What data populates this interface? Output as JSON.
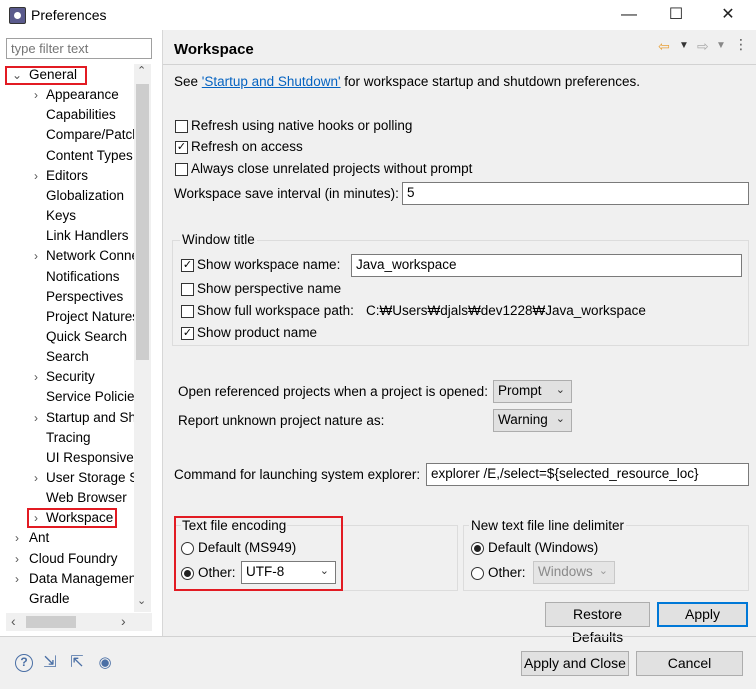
{
  "window": {
    "title": "Preferences",
    "minimize": "—",
    "maximize": "☐",
    "close": "✕"
  },
  "filter": {
    "placeholder": "type filter text"
  },
  "tree": {
    "items": [
      {
        "label": "General",
        "chevron": "⌄"
      },
      {
        "label": "Appearance",
        "chevron": "›"
      },
      {
        "label": "Capabilities",
        "chevron": ""
      },
      {
        "label": "Compare/Patch",
        "chevron": ""
      },
      {
        "label": "Content Types",
        "chevron": ""
      },
      {
        "label": "Editors",
        "chevron": "›"
      },
      {
        "label": "Globalization",
        "chevron": ""
      },
      {
        "label": "Keys",
        "chevron": ""
      },
      {
        "label": "Link Handlers",
        "chevron": ""
      },
      {
        "label": "Network Connections",
        "chevron": "›"
      },
      {
        "label": "Notifications",
        "chevron": ""
      },
      {
        "label": "Perspectives",
        "chevron": ""
      },
      {
        "label": "Project Natures",
        "chevron": ""
      },
      {
        "label": "Quick Search",
        "chevron": ""
      },
      {
        "label": "Search",
        "chevron": ""
      },
      {
        "label": "Security",
        "chevron": "›"
      },
      {
        "label": "Service Policies",
        "chevron": ""
      },
      {
        "label": "Startup and Shutdown",
        "chevron": "›"
      },
      {
        "label": "Tracing",
        "chevron": ""
      },
      {
        "label": "UI Responsiveness",
        "chevron": ""
      },
      {
        "label": "User Storage Service",
        "chevron": "›"
      },
      {
        "label": "Web Browser",
        "chevron": ""
      },
      {
        "label": "Workspace",
        "chevron": "›"
      },
      {
        "label": "Ant",
        "chevron": "›"
      },
      {
        "label": "Cloud Foundry",
        "chevron": "›"
      },
      {
        "label": "Data Management",
        "chevron": "›"
      },
      {
        "label": "Gradle",
        "chevron": ""
      }
    ],
    "scroll_up": "⌃",
    "scroll_down": "⌄",
    "scroll_left": "‹",
    "scroll_right": "›"
  },
  "page": {
    "title": "Workspace",
    "intro_prefix": "See ",
    "intro_link": "'Startup and Shutdown'",
    "intro_suffix": " for workspace startup and shutdown preferences.",
    "refresh_native": {
      "label": "Refresh using native hooks or polling",
      "checked": false
    },
    "refresh_access": {
      "label": "Refresh on access",
      "checked": true
    },
    "always_close": {
      "label": "Always close unrelated projects without prompt",
      "checked": false
    },
    "save_interval_label": "Workspace save interval (in minutes):",
    "save_interval_value": "5",
    "window_title": {
      "group_label": "Window title",
      "show_ws_name": {
        "label": "Show workspace name:",
        "checked": true,
        "value": "Java_workspace"
      },
      "show_perspective": {
        "label": "Show perspective name",
        "checked": false
      },
      "show_full_path": {
        "label": "Show full workspace path:",
        "checked": false,
        "value": "C:₩Users₩djals₩dev1228₩Java_workspace"
      },
      "show_product": {
        "label": "Show product name",
        "checked": true
      }
    },
    "open_ref_label": "Open referenced projects when a project is opened:",
    "open_ref_value": "Prompt",
    "report_unknown_label": "Report unknown project nature as:",
    "report_unknown_value": "Warning",
    "cmd_label": "Command for launching system explorer:",
    "cmd_value": "explorer /E,/select=${selected_resource_loc}",
    "encoding": {
      "group_label": "Text file encoding",
      "default_label": "Default (MS949)",
      "other_label": "Other:",
      "other_value": "UTF-8",
      "selected": "other"
    },
    "line_delim": {
      "group_label": "New text file line delimiter",
      "default_label": "Default (Windows)",
      "other_label": "Other:",
      "other_value": "Windows",
      "selected": "default"
    },
    "restore_defaults": "Restore Defaults",
    "apply": "Apply"
  },
  "footer": {
    "apply_close": "Apply and Close",
    "cancel": "Cancel",
    "icons": [
      "help-icon",
      "import-icon",
      "export-icon",
      "record-icon"
    ]
  },
  "colors": {
    "highlight_box": "#e21b23",
    "link": "#0563c1",
    "default_button_border": "#0078d7"
  }
}
